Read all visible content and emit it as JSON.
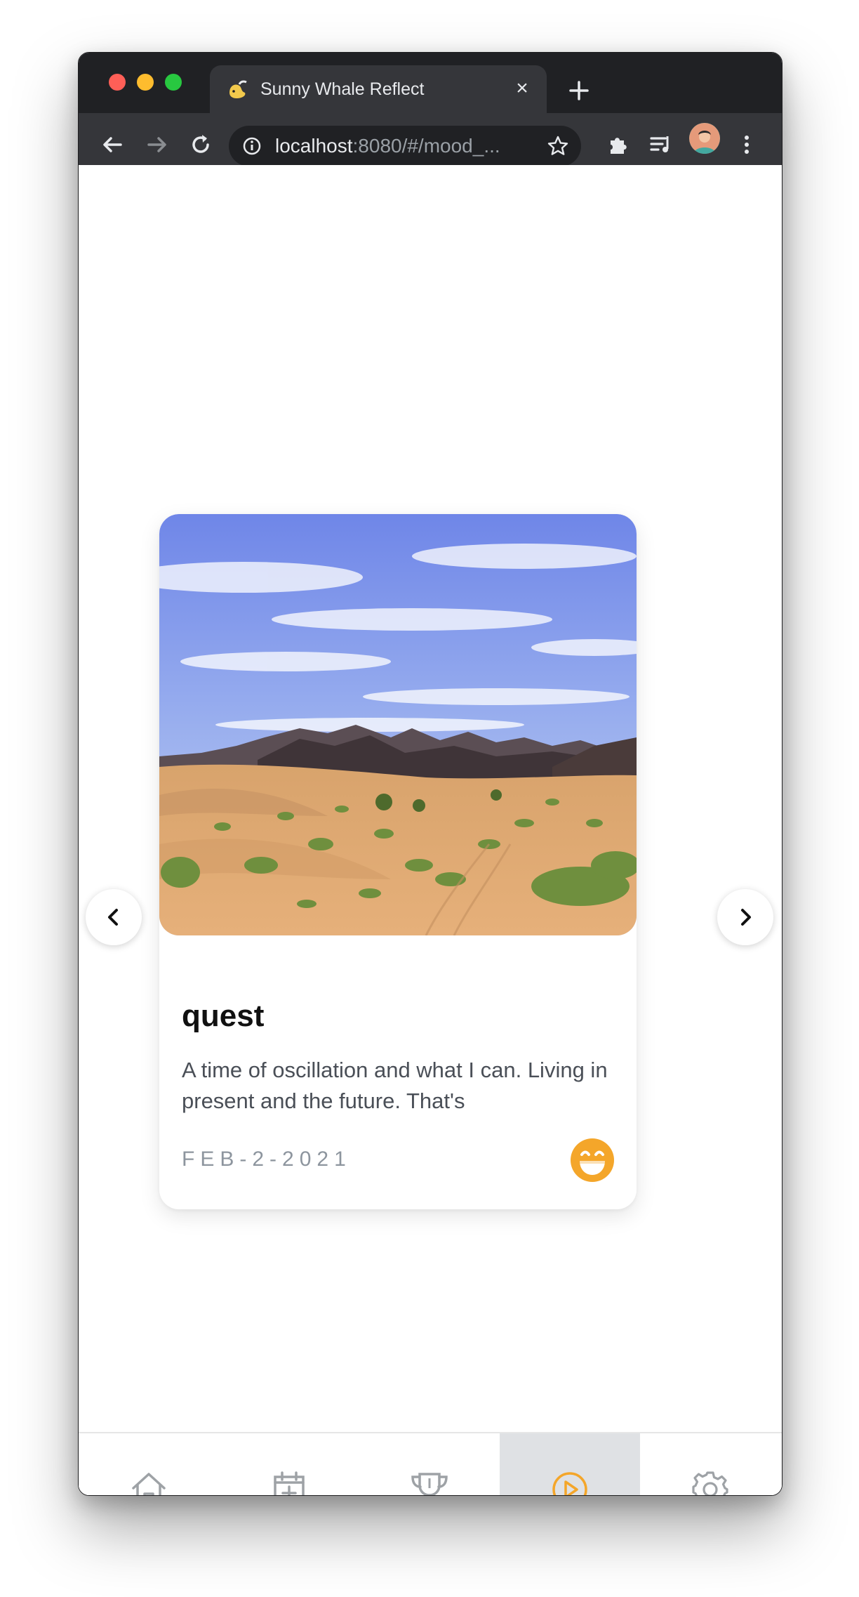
{
  "browser": {
    "tab_title": "Sunny Whale Reflect",
    "url_host": "localhost",
    "url_rest": ":8080/#/mood_..."
  },
  "entry": {
    "title": "quest",
    "description": "A time of oscillation and what I can. Living in present and the future. That's",
    "date": "FEB-2-2021",
    "mood_icon": "grinning-face-icon"
  },
  "bottom_nav": {
    "items": [
      "home-icon",
      "calendar-add-icon",
      "trophy-icon",
      "play-icon",
      "settings-icon"
    ],
    "active": "play-icon"
  },
  "colors": {
    "accent": "#f4a62a",
    "nav_active_bg": "#dfe1e4",
    "chrome_dark": "#202124",
    "chrome_toolbar": "#35363a"
  }
}
